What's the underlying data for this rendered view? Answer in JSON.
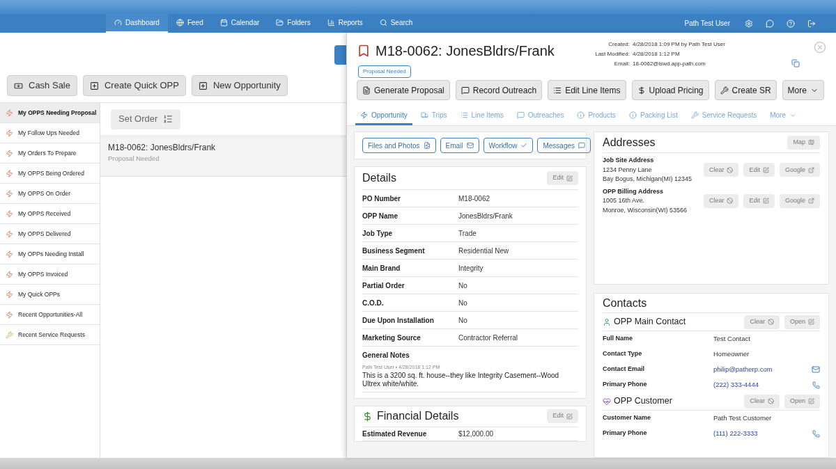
{
  "nav": {
    "items": [
      {
        "label": "Dashboard",
        "selected": true
      },
      {
        "label": "Feed",
        "selected": false
      },
      {
        "label": "Calendar",
        "selected": false
      },
      {
        "label": "Folders",
        "selected": false
      },
      {
        "label": "Reports",
        "selected": false
      },
      {
        "label": "Search",
        "selected": false
      }
    ],
    "user": "Path Test User"
  },
  "toolbar": [
    "Cash Sale",
    "Create Quick OPP",
    "New Opportunity"
  ],
  "sidebar": [
    {
      "label": "My OPPS Needing Proposal",
      "selected": true,
      "kind": "opp"
    },
    {
      "label": "My Follow Ups Needed",
      "selected": false,
      "kind": "opp"
    },
    {
      "label": "My Orders To Prepare",
      "selected": false,
      "kind": "opp"
    },
    {
      "label": "My OPPS Being Ordered",
      "selected": false,
      "kind": "opp"
    },
    {
      "label": "My OPPS On Order",
      "selected": false,
      "kind": "opp"
    },
    {
      "label": "My OPPS Received",
      "selected": false,
      "kind": "opp"
    },
    {
      "label": "My OPPS Delivered",
      "selected": false,
      "kind": "opp"
    },
    {
      "label": "My OPPs Needing Install",
      "selected": false,
      "kind": "opp"
    },
    {
      "label": "My OPPS Invoiced",
      "selected": false,
      "kind": "opp"
    },
    {
      "label": "My Quick OPPs",
      "selected": false,
      "kind": "opp"
    },
    {
      "label": "Recent Opportunities-All",
      "selected": false,
      "kind": "opp"
    },
    {
      "label": "Recent Service Requests",
      "selected": false,
      "kind": "service"
    }
  ],
  "list": {
    "set_order": "Set Order",
    "rows": [
      {
        "title": "M18-0062: JonesBldrs/Frank",
        "status": "Proposal Needed",
        "selected": true
      }
    ]
  },
  "record": {
    "title": "M18-0062: JonesBldrs/Frank",
    "status": "Proposal Needed",
    "meta": [
      {
        "label": "Created:",
        "value": "4/28/2018 1:09 PM by Path Test User"
      },
      {
        "label": "Last Modified:",
        "value": "4/28/2018 1:12 PM"
      },
      {
        "label": "Email:",
        "value": "18-0062@lswd.app-path.com"
      }
    ],
    "actions": [
      "Generate Proposal",
      "Record Outreach",
      "Edit Line Items",
      "Upload Pricing",
      "Create SR",
      "More"
    ],
    "tabs": [
      {
        "label": "Opportunity",
        "selected": true
      },
      {
        "label": "Trips",
        "selected": false
      },
      {
        "label": "Line Items",
        "selected": false
      },
      {
        "label": "Outreaches",
        "selected": false
      },
      {
        "label": "Products",
        "selected": false
      },
      {
        "label": "Packing List",
        "selected": false
      },
      {
        "label": "Service Requests",
        "selected": false
      },
      {
        "label": "More",
        "selected": false
      }
    ],
    "quick_buttons": [
      "Files and Photos",
      "Email",
      "Workflow",
      "Messages"
    ],
    "details": {
      "title": "Details",
      "edit": "Edit",
      "fields": [
        {
          "label": "PO Number",
          "value": "M18-0062"
        },
        {
          "label": "OPP Name",
          "value": "JonesBldrs/Frank"
        },
        {
          "label": "Job Type",
          "value": "Trade"
        },
        {
          "label": "Business Segment",
          "value": "Residential New"
        },
        {
          "label": "Main Brand",
          "value": "Integrity"
        },
        {
          "label": "Partial Order",
          "value": "No"
        },
        {
          "label": "C.O.D.",
          "value": "No"
        },
        {
          "label": "Due Upon Installation",
          "value": "No"
        },
        {
          "label": "Marketing Source",
          "value": "Contractor Referral"
        }
      ],
      "notes": {
        "label": "General Notes",
        "author": "Path Test User • 4/28/2018 1:12 PM",
        "text": "This is a 3200 sq. ft. house--they like Integrity Casement--Wood Ultrex white/white."
      }
    },
    "financial": {
      "title": "Financial Details",
      "edit": "Edit",
      "fields": [
        {
          "label": "Estimated Revenue",
          "value": "$12,000.00"
        }
      ]
    },
    "addresses": {
      "title": "Addresses",
      "map": "Map",
      "items": [
        {
          "label": "Job Site Address",
          "lines": [
            "1234 Penny Lane",
            "Bay Bogus, Michigan(MI) 12345"
          ],
          "buttons": [
            "Clear",
            "Edit",
            "Google"
          ]
        },
        {
          "label": "OPP Billing Address",
          "lines": [
            "1005 16th Ave.",
            "Monroe, Wisconsin(WI) 53566"
          ],
          "buttons": [
            "Clear",
            "Edit",
            "Google"
          ]
        }
      ]
    },
    "contacts": {
      "title": "Contacts",
      "groups": [
        {
          "title": "OPP Main Contact",
          "kind": "person",
          "buttons": [
            "Clear",
            "Open"
          ],
          "fields": [
            {
              "label": "Full Name",
              "value": "Test Contact",
              "kind": "text"
            },
            {
              "label": "Contact Type",
              "value": "Homeowner",
              "kind": "text"
            },
            {
              "label": "Contact Email",
              "value": "philip@patherp.com",
              "kind": "email"
            },
            {
              "label": "Primary Phone",
              "value": "(222) 333-4444",
              "kind": "phone"
            }
          ]
        },
        {
          "title": "OPP Customer",
          "kind": "customer",
          "buttons": [
            "Clear",
            "Open"
          ],
          "fields": [
            {
              "label": "Customer Name",
              "value": "Path Test Customer",
              "kind": "text"
            },
            {
              "label": "Primary Phone",
              "value": "(111) 222-3333",
              "kind": "phone"
            }
          ]
        }
      ]
    }
  }
}
